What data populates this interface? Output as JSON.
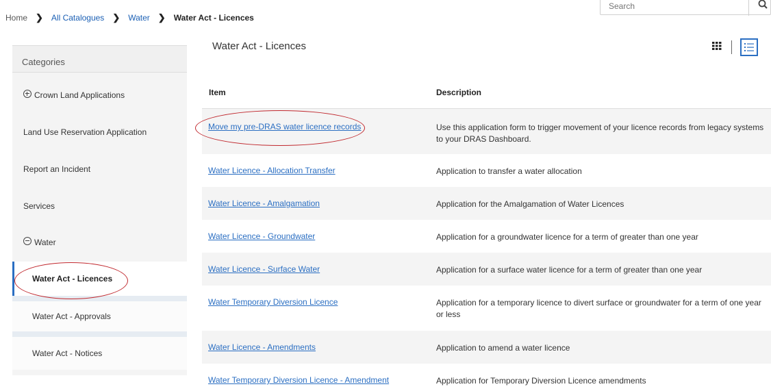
{
  "breadcrumb": {
    "items": [
      "Home",
      "All Catalogues",
      "Water",
      "Water Act - Licences"
    ]
  },
  "search": {
    "placeholder": "Search"
  },
  "sidebar": {
    "header": "Categories",
    "items": [
      {
        "label": "Crown Land Applications"
      },
      {
        "label": "Land Use Reservation Application"
      },
      {
        "label": "Report an Incident"
      },
      {
        "label": "Services"
      },
      {
        "label": "Water"
      },
      {
        "label": "Water Act - Licences"
      },
      {
        "label": "Water Act - Approvals"
      },
      {
        "label": "Water Act - Notices"
      }
    ]
  },
  "main": {
    "title": "Water Act - Licences",
    "columns": [
      "Item",
      "Description"
    ],
    "rows": [
      {
        "item": "Move my pre-DRAS water licence records",
        "description": "Use this application form to trigger movement of your licence records from legacy systems to your DRAS Dashboard."
      },
      {
        "item": "Water Licence - Allocation Transfer",
        "description": "Application to transfer a water allocation"
      },
      {
        "item": "Water Licence - Amalgamation",
        "description": "Application for the Amalgamation of Water Licences"
      },
      {
        "item": "Water Licence - Groundwater",
        "description": "Application for a groundwater licence for a term of greater than one year"
      },
      {
        "item": "Water Licence - Surface Water",
        "description": "Application for a surface water licence for a term of greater than one year"
      },
      {
        "item": "Water Temporary Diversion Licence",
        "description": "Application for a temporary licence to divert surface or groundwater for a term of one year or less"
      },
      {
        "item": "Water Licence - Amendments",
        "description": "Application to amend a water licence"
      },
      {
        "item": "Water Temporary Diversion Licence - Amendment",
        "description": "Application for Temporary Diversion Licence amendments"
      }
    ]
  },
  "colors": {
    "link": "#2a6ec2",
    "annotation": "#c0272d",
    "active_border": "#2a6ec2"
  },
  "icons": [
    "search-icon",
    "grid-view-icon",
    "list-view-icon",
    "plus-circle-icon",
    "minus-circle-icon",
    "chevron-right-icon"
  ]
}
